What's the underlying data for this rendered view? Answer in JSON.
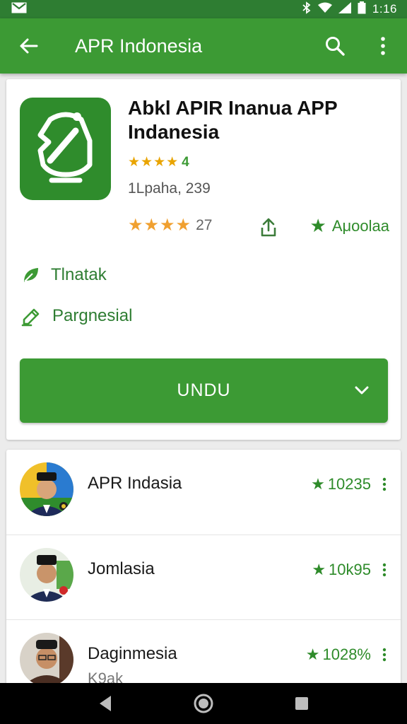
{
  "status_bar": {
    "time": "1:16"
  },
  "app_bar": {
    "title": "APR Indonesia"
  },
  "app": {
    "name": "Abkl APIR Inanua APP Indanesia",
    "small_rating": "4",
    "meta": "1Lpaha, 239",
    "rating_count": "27",
    "badge": "Aμοolaa"
  },
  "features": [
    {
      "label": "Tlnatak"
    },
    {
      "label": "Pargnesial"
    }
  ],
  "install": {
    "label": "UNDU"
  },
  "list": [
    {
      "name": "APR Indasia",
      "score": "10235",
      "sub": ""
    },
    {
      "name": "Jomlasia",
      "score": "10k95",
      "sub": ""
    },
    {
      "name": "Daginmesia",
      "score": "1028%",
      "sub": "K9ak"
    }
  ],
  "colors": {
    "primary": "#3c9a34",
    "status_bar": "#2e7d32",
    "accent_star": "#f0a030",
    "text_green": "#2e7d32"
  },
  "icons": {
    "back": "arrow-left",
    "search": "magnifier",
    "overflow": "vertical-dots",
    "share": "share-up-arrow",
    "badge": "star",
    "feature_1": "leaf",
    "feature_2": "pen-edit",
    "install_dropdown": "chevron-down",
    "nav_back": "triangle",
    "nav_home": "circle",
    "nav_recents": "square"
  }
}
